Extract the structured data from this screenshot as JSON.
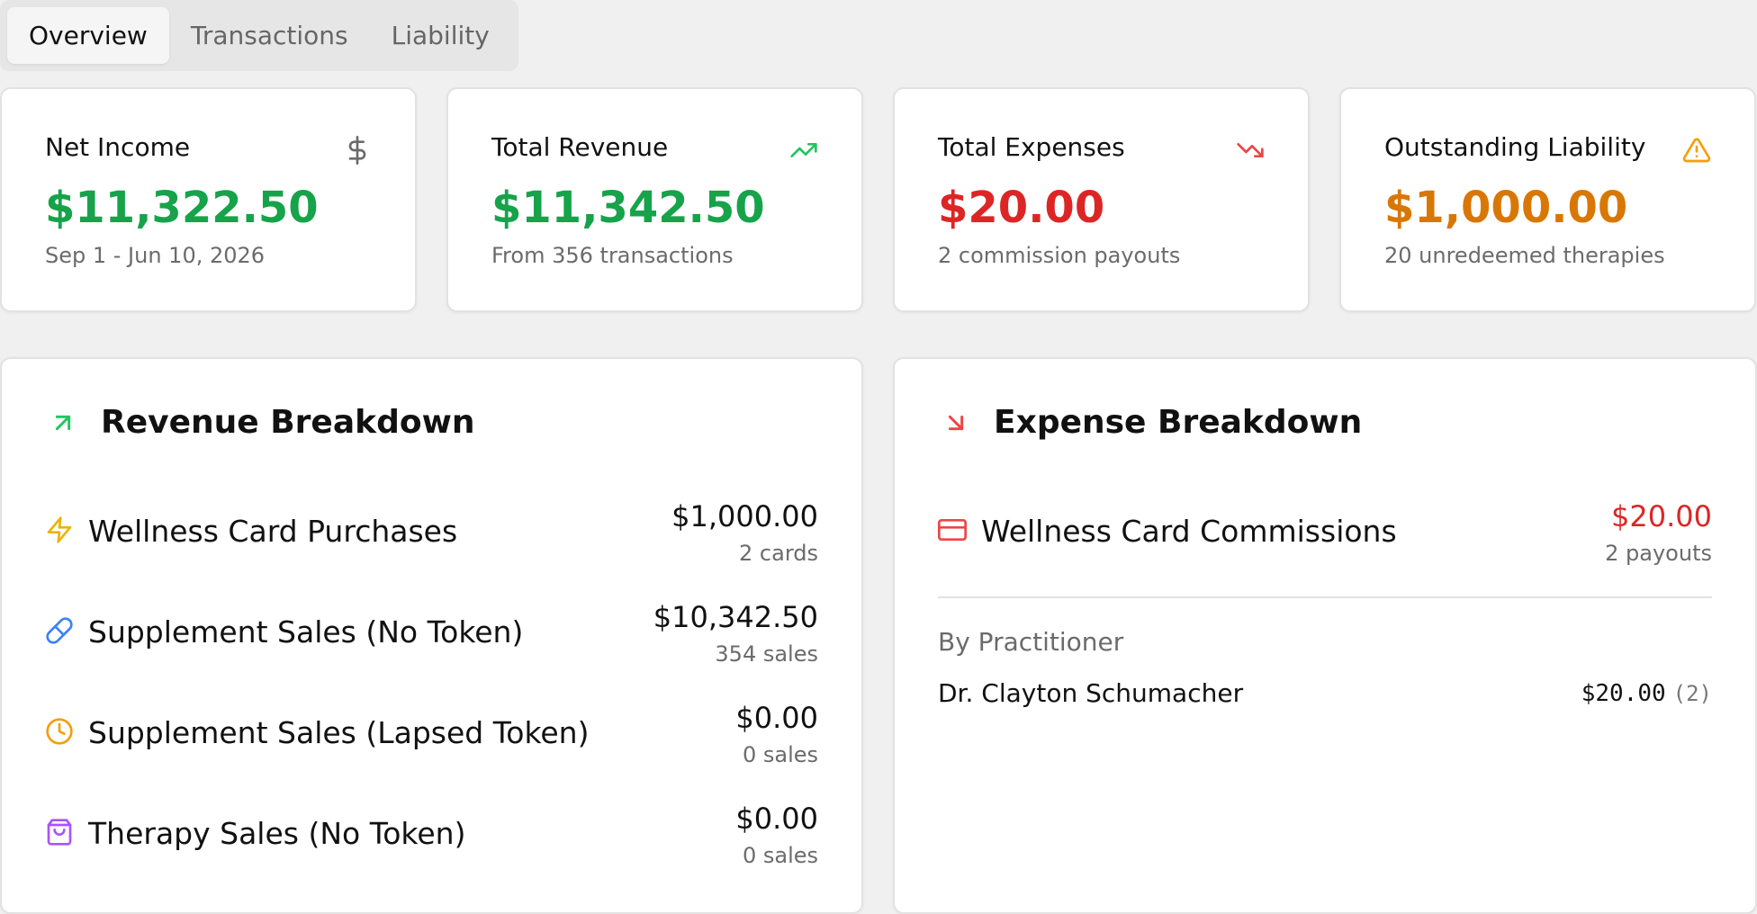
{
  "tabs": [
    {
      "label": "Overview",
      "active": true
    },
    {
      "label": "Transactions",
      "active": false
    },
    {
      "label": "Liability",
      "active": false
    }
  ],
  "stats": [
    {
      "label": "Net Income",
      "value": "$11,322.50",
      "sub": "Sep 1 - Jun 10, 2026",
      "icon": "dollar-icon",
      "value_color": "#16a34a",
      "icon_color": "#6b6b6b"
    },
    {
      "label": "Total Revenue",
      "value": "$11,342.50",
      "sub": "From 356 transactions",
      "icon": "trending-up-icon",
      "value_color": "#16a34a",
      "icon_color": "#22c55e"
    },
    {
      "label": "Total Expenses",
      "value": "$20.00",
      "sub": "2 commission payouts",
      "icon": "trending-down-icon",
      "value_color": "#dc2626",
      "icon_color": "#ef4444"
    },
    {
      "label": "Outstanding Liability",
      "value": "$1,000.00",
      "sub": "20 unredeemed therapies",
      "icon": "warning-icon",
      "value_color": "#d97706",
      "icon_color": "#f59e0b"
    }
  ],
  "revenue": {
    "title": "Revenue Breakdown",
    "icon": "arrow-up-right-icon",
    "rows": [
      {
        "label": "Wellness Card Purchases",
        "amount": "$1,000.00",
        "count": "2 cards",
        "icon": "lightning-icon",
        "icon_color": "#eab308"
      },
      {
        "label": "Supplement Sales (No Token)",
        "amount": "$10,342.50",
        "count": "354 sales",
        "icon": "pill-icon",
        "icon_color": "#3b82f6"
      },
      {
        "label": "Supplement Sales (Lapsed Token)",
        "amount": "$0.00",
        "count": "0 sales",
        "icon": "clock-icon",
        "icon_color": "#f59e0b"
      },
      {
        "label": "Therapy Sales (No Token)",
        "amount": "$0.00",
        "count": "0 sales",
        "icon": "shopping-bag-icon",
        "icon_color": "#a855f7"
      }
    ]
  },
  "expense": {
    "title": "Expense Breakdown",
    "icon": "arrow-down-right-icon",
    "rows": [
      {
        "label": "Wellness Card Commissions",
        "amount": "$20.00",
        "count": "2 payouts",
        "icon": "credit-card-icon",
        "icon_color": "#ef4444",
        "amount_color": "#dc2626"
      }
    ],
    "by_practitioner_label": "By Practitioner",
    "practitioners": [
      {
        "name": "Dr. Clayton Schumacher",
        "amount": "$20.00",
        "count": "(2)"
      }
    ]
  }
}
